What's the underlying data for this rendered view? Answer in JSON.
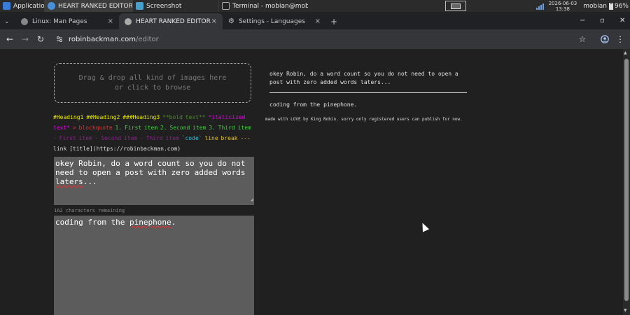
{
  "taskbar": {
    "apps_label": "Applications",
    "windows": [
      {
        "label": "HEART RANKED EDITOR - ..."
      },
      {
        "label": "Screenshot"
      },
      {
        "label": "Terminal - mobian@mobia..."
      }
    ],
    "date": "2026-06-03",
    "time": "13:38",
    "user": "mobian",
    "battery": "96%"
  },
  "tabs": [
    {
      "label": "Linux: Man Pages",
      "close": "×"
    },
    {
      "label": "HEART RANKED EDITOR",
      "close": "×"
    },
    {
      "label": "Settings - Languages",
      "close": "×"
    }
  ],
  "new_tab": "+",
  "window_controls": {
    "minimize": "−",
    "maximize": "▫",
    "close": "✕"
  },
  "address": {
    "domain": "robinbackman.com",
    "path": "/editor"
  },
  "nav": {
    "back": "←",
    "forward": "→",
    "reload": "↻",
    "star": "☆",
    "menu": "⋮"
  },
  "editor": {
    "dropzone_line1": "Drag & drop all kind of images here",
    "dropzone_line2": "or click to browse",
    "md_help": {
      "h1": "#Heading1",
      "h2": "##Heading2",
      "h3": "###Heading3",
      "bold": "**bold text**",
      "italic": "*italicized text*",
      "blockquote": "> blockquote",
      "ol": "1. First item 2. Second item 3. Third item",
      "ul": "- First item - Second item - Third item",
      "code": "`code`",
      "linebreak": "line break ---",
      "link": "link [title](https://robinbackman.com)"
    },
    "title_text": "okey Robin, do a word count so you do not need to open a post with zero added words laters...",
    "title_spell": "laters",
    "remaining": "162 characters remaining",
    "body_text_before": "coding from the ",
    "body_spell": "pinephone",
    "body_text_after": "."
  },
  "preview": {
    "title": "okey Robin, do a word count so you do not need to open a post with zero added words laters...",
    "body": "coding from the pinephone.",
    "footer": "made with LOVE by King Robin. sorry only registered users can publish for now."
  }
}
